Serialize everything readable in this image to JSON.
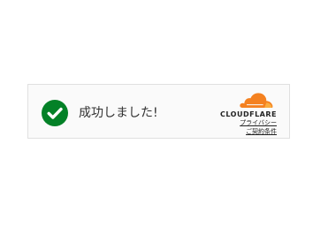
{
  "status": {
    "message": "成功しました!",
    "icon": "check-circle-icon",
    "color": "#038127"
  },
  "brand": {
    "logo_icon": "cloudflare-cloud-icon",
    "name": "CLOUDFLARE",
    "color": "#f48120"
  },
  "links": {
    "privacy": "プライバシー",
    "terms": "ご契約条件"
  }
}
